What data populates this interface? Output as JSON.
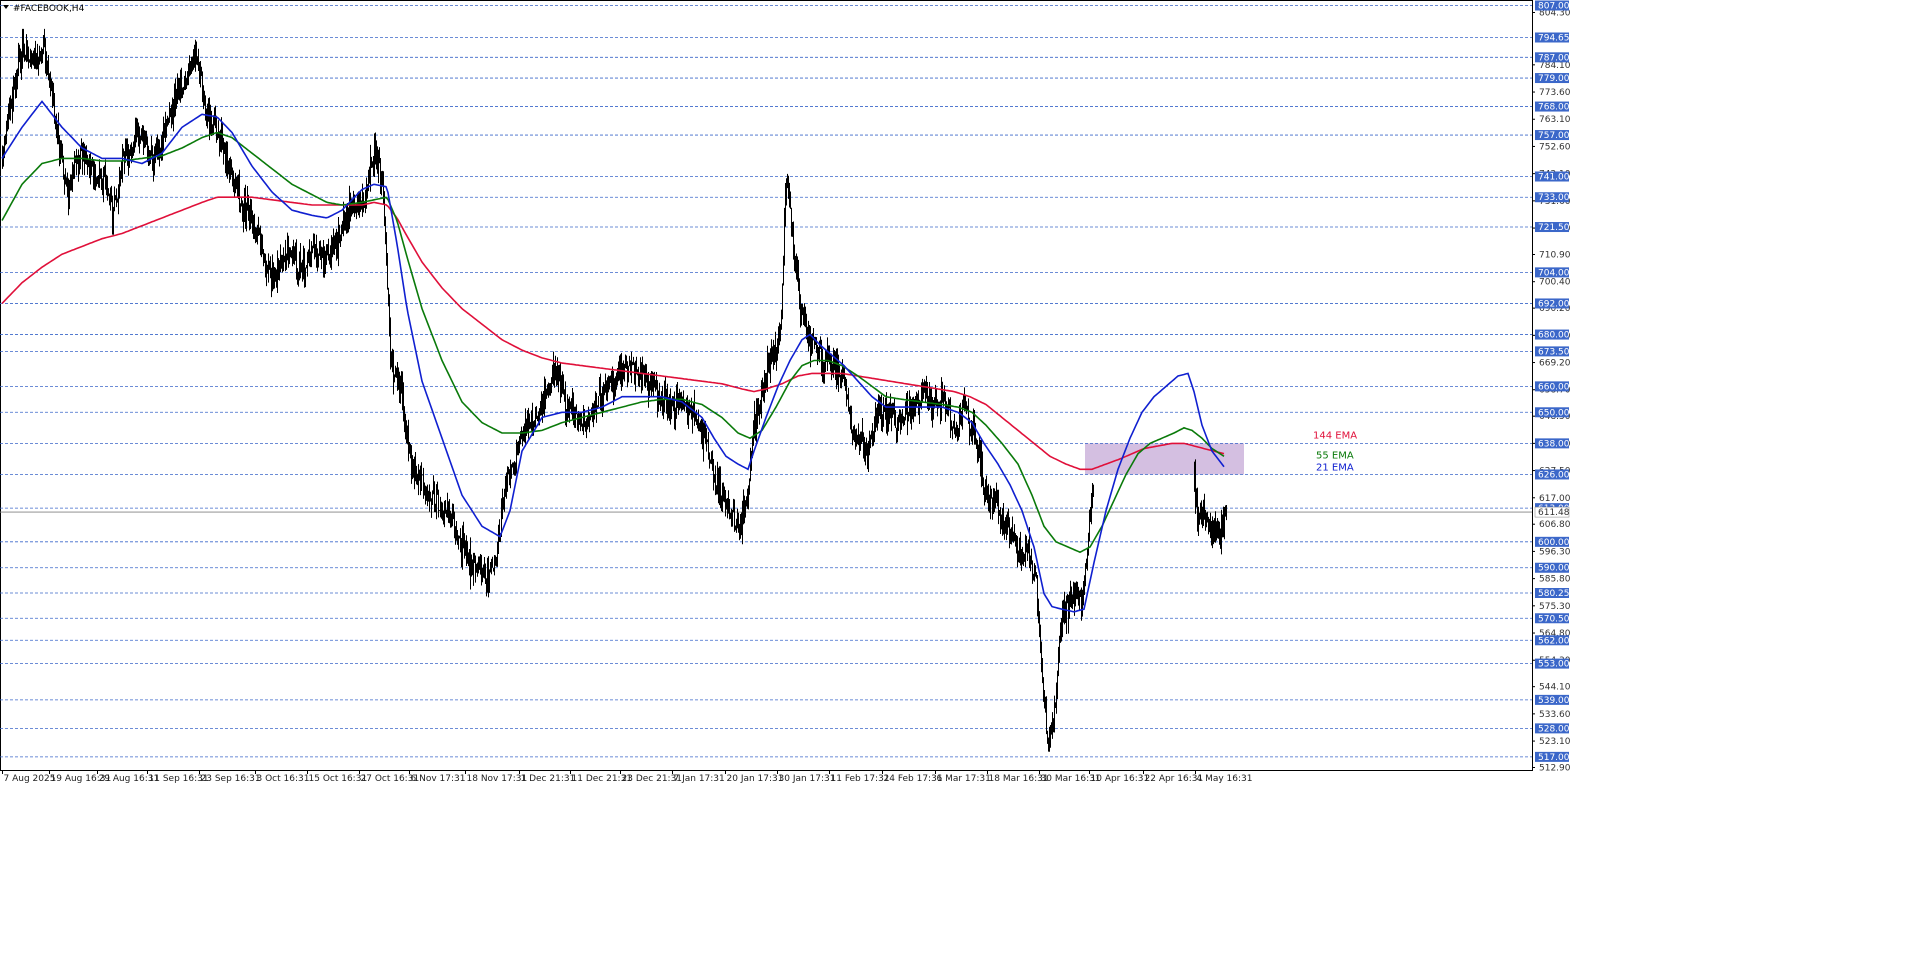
{
  "window": {
    "symbol_title": "#FACEBOOK,H4"
  },
  "colors": {
    "background": "#ffffff",
    "grid": "#3b67c9",
    "candle": "#000000",
    "ema21": "#1020d0",
    "ema55": "#0a7a0a",
    "ema144": "#e0103a",
    "zone": "#cdb4dc",
    "label_box": "#3b67c9"
  },
  "chart_data": {
    "type": "candlestick",
    "timeframe": "H4",
    "ylim": [
      512.9,
      807.0
    ],
    "level_lines": [
      807.0,
      794.65,
      787.0,
      779.0,
      768.0,
      757.0,
      741.0,
      733.0,
      721.5,
      704.0,
      692.0,
      680.0,
      673.5,
      660.0,
      650.0,
      638.0,
      626.0,
      613.0,
      600.0,
      590.0,
      580.25,
      570.5,
      562.0,
      553.0,
      539.0,
      528.0,
      517.0
    ],
    "level_labels": [
      "807.00",
      "794.65",
      "787.00",
      "779.00",
      "768.00",
      "757.00",
      "741.00",
      "733.00",
      "721.50",
      "704.00",
      "692.00",
      "680.00",
      "673.50",
      "660.00",
      "650.00",
      "638.00",
      "626.00",
      "613.00",
      "600.00",
      "590.00",
      "580.25",
      "570.50",
      "562.00",
      "553.00",
      "539.00",
      "528.00",
      "517.00"
    ],
    "y_ticks": [
      "804.30",
      "784.10",
      "773.60",
      "763.10",
      "752.60",
      "742.10",
      "731.60",
      "721.10",
      "710.90",
      "700.40",
      "690.20",
      "679.70",
      "669.20",
      "658.70",
      "648.50",
      "638.00",
      "627.50",
      "617.00",
      "606.80",
      "596.30",
      "585.80",
      "575.30",
      "564.80",
      "554.30",
      "544.10",
      "533.60",
      "523.10",
      "512.90"
    ],
    "y_tick_values": [
      804.3,
      784.1,
      773.6,
      763.1,
      752.6,
      742.1,
      731.6,
      721.1,
      710.9,
      700.4,
      690.2,
      679.7,
      669.2,
      658.7,
      648.5,
      638.0,
      627.5,
      617.0,
      606.8,
      596.3,
      585.8,
      575.3,
      564.8,
      554.3,
      544.1,
      533.6,
      523.1,
      512.9
    ],
    "current_price": "611.48",
    "current_price_value": 611.48,
    "x_ticks": [
      "7 Aug 2025",
      "19 Aug 16:31",
      "29 Aug 16:31",
      "11 Sep 16:31",
      "23 Sep 16:31",
      "3 Oct 16:31",
      "15 Oct 16:31",
      "27 Oct 16:31",
      "6 Nov 17:31",
      "18 Nov 17:31",
      "1 Dec 21:31",
      "11 Dec 21:31",
      "23 Dec 21:31",
      "7 Jan 17:31",
      "20 Jan 17:31",
      "30 Jan 17:31",
      "11 Feb 17:31",
      "24 Feb 17:31",
      "6 Mar 17:31",
      "18 Mar 16:31",
      "30 Mar 16:31",
      "10 Apr 16:31",
      "22 Apr 16:31",
      "4 May 16:31"
    ],
    "x_tick_index": [
      0,
      47,
      95,
      145,
      197,
      253,
      305,
      357,
      407,
      463,
      517,
      568,
      618,
      670,
      723,
      775,
      827,
      880,
      933,
      985,
      1037,
      1087,
      1141,
      1193
    ],
    "n_bars": 1225,
    "price_anchors": [
      [
        0,
        748
      ],
      [
        4,
        760
      ],
      [
        10,
        772
      ],
      [
        20,
        790
      ],
      [
        28,
        785
      ],
      [
        42,
        788
      ],
      [
        50,
        770
      ],
      [
        58,
        748
      ],
      [
        66,
        735
      ],
      [
        78,
        752
      ],
      [
        92,
        742
      ],
      [
        104,
        740
      ],
      [
        110,
        725
      ],
      [
        122,
        748
      ],
      [
        135,
        758
      ],
      [
        150,
        748
      ],
      [
        160,
        755
      ],
      [
        172,
        770
      ],
      [
        185,
        782
      ],
      [
        195,
        788
      ],
      [
        204,
        765
      ],
      [
        215,
        760
      ],
      [
        230,
        740
      ],
      [
        242,
        728
      ],
      [
        252,
        722
      ],
      [
        262,
        710
      ],
      [
        272,
        700
      ],
      [
        285,
        712
      ],
      [
        298,
        705
      ],
      [
        312,
        712
      ],
      [
        325,
        710
      ],
      [
        340,
        720
      ],
      [
        350,
        732
      ],
      [
        362,
        732
      ],
      [
        372,
        750
      ],
      [
        380,
        740
      ],
      [
        388,
        672
      ],
      [
        398,
        660
      ],
      [
        410,
        628
      ],
      [
        420,
        622
      ],
      [
        432,
        618
      ],
      [
        445,
        612
      ],
      [
        458,
        600
      ],
      [
        472,
        590
      ],
      [
        484,
        588
      ],
      [
        494,
        592
      ],
      [
        502,
        620
      ],
      [
        512,
        632
      ],
      [
        522,
        645
      ],
      [
        534,
        648
      ],
      [
        546,
        662
      ],
      [
        554,
        668
      ],
      [
        564,
        652
      ],
      [
        578,
        645
      ],
      [
        592,
        652
      ],
      [
        604,
        660
      ],
      [
        616,
        665
      ],
      [
        630,
        668
      ],
      [
        642,
        662
      ],
      [
        656,
        658
      ],
      [
        668,
        652
      ],
      [
        680,
        655
      ],
      [
        692,
        648
      ],
      [
        702,
        640
      ],
      [
        712,
        625
      ],
      [
        724,
        615
      ],
      [
        736,
        605
      ],
      [
        744,
        615
      ],
      [
        752,
        645
      ],
      [
        760,
        660
      ],
      [
        770,
        670
      ],
      [
        778,
        680
      ],
      [
        784,
        740
      ],
      [
        790,
        718
      ],
      [
        798,
        690
      ],
      [
        808,
        678
      ],
      [
        818,
        672
      ],
      [
        830,
        668
      ],
      [
        842,
        662
      ],
      [
        852,
        640
      ],
      [
        864,
        635
      ],
      [
        876,
        650
      ],
      [
        888,
        652
      ],
      [
        898,
        645
      ],
      [
        910,
        652
      ],
      [
        922,
        658
      ],
      [
        934,
        652
      ],
      [
        944,
        655
      ],
      [
        952,
        640
      ],
      [
        962,
        652
      ],
      [
        974,
        638
      ],
      [
        984,
        618
      ],
      [
        996,
        614
      ],
      [
        1006,
        605
      ],
      [
        1016,
        595
      ],
      [
        1026,
        596
      ],
      [
        1034,
        582
      ],
      [
        1040,
        545
      ],
      [
        1046,
        522
      ],
      [
        1052,
        535
      ],
      [
        1058,
        568
      ],
      [
        1064,
        575
      ],
      [
        1072,
        580
      ],
      [
        1080,
        575
      ],
      [
        1088,
        612
      ],
      [
        1096,
        628
      ],
      [
        1104,
        632
      ],
      [
        1112,
        640
      ],
      [
        1116,
        672
      ],
      [
        1124,
        668
      ],
      [
        1132,
        672
      ],
      [
        1138,
        688
      ],
      [
        1146,
        675
      ],
      [
        1156,
        668
      ],
      [
        1164,
        658
      ],
      [
        1172,
        672
      ],
      [
        1180,
        672
      ],
      [
        1186,
        668
      ],
      [
        1190,
        665
      ],
      [
        1193,
        612
      ],
      [
        1200,
        610
      ],
      [
        1208,
        607
      ],
      [
        1214,
        605
      ],
      [
        1218,
        602
      ],
      [
        1222,
        610
      ],
      [
        1224,
        611.48
      ]
    ],
    "ema21_anchors": [
      [
        0,
        748
      ],
      [
        20,
        760
      ],
      [
        40,
        770
      ],
      [
        60,
        760
      ],
      [
        80,
        752
      ],
      [
        100,
        748
      ],
      [
        120,
        748
      ],
      [
        140,
        746
      ],
      [
        160,
        750
      ],
      [
        180,
        760
      ],
      [
        200,
        765
      ],
      [
        215,
        764
      ],
      [
        230,
        758
      ],
      [
        250,
        745
      ],
      [
        270,
        735
      ],
      [
        290,
        728
      ],
      [
        310,
        726
      ],
      [
        325,
        725
      ],
      [
        340,
        728
      ],
      [
        360,
        736
      ],
      [
        372,
        738
      ],
      [
        385,
        737
      ],
      [
        395,
        715
      ],
      [
        405,
        690
      ],
      [
        420,
        662
      ],
      [
        440,
        640
      ],
      [
        460,
        618
      ],
      [
        480,
        606
      ],
      [
        498,
        602
      ],
      [
        508,
        612
      ],
      [
        520,
        635
      ],
      [
        540,
        648
      ],
      [
        560,
        650
      ],
      [
        580,
        650
      ],
      [
        600,
        652
      ],
      [
        620,
        656
      ],
      [
        640,
        656
      ],
      [
        660,
        656
      ],
      [
        680,
        654
      ],
      [
        700,
        648
      ],
      [
        712,
        640
      ],
      [
        724,
        633
      ],
      [
        736,
        630
      ],
      [
        746,
        628
      ],
      [
        752,
        635
      ],
      [
        764,
        648
      ],
      [
        776,
        660
      ],
      [
        788,
        670
      ],
      [
        800,
        678
      ],
      [
        808,
        680
      ],
      [
        818,
        676
      ],
      [
        830,
        672
      ],
      [
        842,
        668
      ],
      [
        856,
        662
      ],
      [
        870,
        656
      ],
      [
        884,
        652
      ],
      [
        900,
        652
      ],
      [
        920,
        652
      ],
      [
        940,
        652
      ],
      [
        956,
        650
      ],
      [
        970,
        646
      ],
      [
        982,
        638
      ],
      [
        996,
        630
      ],
      [
        1008,
        622
      ],
      [
        1020,
        612
      ],
      [
        1032,
        598
      ],
      [
        1042,
        580
      ],
      [
        1050,
        575
      ],
      [
        1060,
        574
      ],
      [
        1072,
        573
      ],
      [
        1082,
        574
      ],
      [
        1092,
        592
      ],
      [
        1104,
        612
      ],
      [
        1116,
        628
      ],
      [
        1128,
        640
      ],
      [
        1140,
        650
      ],
      [
        1152,
        656
      ],
      [
        1164,
        660
      ],
      [
        1176,
        664
      ],
      [
        1186,
        665
      ],
      [
        1192,
        658
      ],
      [
        1200,
        645
      ],
      [
        1210,
        635
      ],
      [
        1218,
        631
      ],
      [
        1222,
        629
      ]
    ],
    "ema55_anchors": [
      [
        0,
        724
      ],
      [
        20,
        738
      ],
      [
        40,
        746
      ],
      [
        60,
        748
      ],
      [
        80,
        748
      ],
      [
        100,
        747
      ],
      [
        120,
        747
      ],
      [
        140,
        748
      ],
      [
        160,
        749
      ],
      [
        180,
        752
      ],
      [
        200,
        756
      ],
      [
        215,
        758
      ],
      [
        230,
        756
      ],
      [
        250,
        750
      ],
      [
        270,
        744
      ],
      [
        290,
        738
      ],
      [
        310,
        734
      ],
      [
        325,
        731
      ],
      [
        340,
        730
      ],
      [
        360,
        731
      ],
      [
        372,
        732
      ],
      [
        385,
        733
      ],
      [
        395,
        724
      ],
      [
        405,
        710
      ],
      [
        420,
        690
      ],
      [
        440,
        670
      ],
      [
        460,
        654
      ],
      [
        480,
        646
      ],
      [
        500,
        642
      ],
      [
        520,
        642
      ],
      [
        540,
        643
      ],
      [
        560,
        646
      ],
      [
        580,
        648
      ],
      [
        600,
        650
      ],
      [
        620,
        652
      ],
      [
        640,
        654
      ],
      [
        660,
        655
      ],
      [
        680,
        655
      ],
      [
        700,
        653
      ],
      [
        720,
        648
      ],
      [
        736,
        642
      ],
      [
        748,
        640
      ],
      [
        760,
        643
      ],
      [
        774,
        652
      ],
      [
        788,
        662
      ],
      [
        800,
        668
      ],
      [
        812,
        670
      ],
      [
        826,
        670
      ],
      [
        840,
        668
      ],
      [
        856,
        664
      ],
      [
        870,
        660
      ],
      [
        884,
        656
      ],
      [
        900,
        655
      ],
      [
        920,
        654
      ],
      [
        940,
        653
      ],
      [
        956,
        652
      ],
      [
        970,
        650
      ],
      [
        984,
        645
      ],
      [
        1000,
        638
      ],
      [
        1016,
        630
      ],
      [
        1030,
        618
      ],
      [
        1042,
        606
      ],
      [
        1054,
        600
      ],
      [
        1066,
        598
      ],
      [
        1078,
        596
      ],
      [
        1088,
        598
      ],
      [
        1100,
        606
      ],
      [
        1112,
        616
      ],
      [
        1124,
        626
      ],
      [
        1136,
        634
      ],
      [
        1148,
        638
      ],
      [
        1160,
        640
      ],
      [
        1172,
        642
      ],
      [
        1182,
        644
      ],
      [
        1190,
        643
      ],
      [
        1200,
        640
      ],
      [
        1210,
        636
      ],
      [
        1218,
        634
      ],
      [
        1222,
        633
      ]
    ],
    "ema144_anchors": [
      [
        0,
        692
      ],
      [
        20,
        700
      ],
      [
        40,
        706
      ],
      [
        60,
        711
      ],
      [
        80,
        714
      ],
      [
        100,
        717
      ],
      [
        120,
        719
      ],
      [
        140,
        722
      ],
      [
        160,
        725
      ],
      [
        180,
        728
      ],
      [
        200,
        731
      ],
      [
        215,
        733
      ],
      [
        230,
        733
      ],
      [
        250,
        733
      ],
      [
        270,
        732
      ],
      [
        290,
        731
      ],
      [
        310,
        730
      ],
      [
        325,
        730
      ],
      [
        340,
        730
      ],
      [
        360,
        730
      ],
      [
        372,
        731
      ],
      [
        385,
        730
      ],
      [
        395,
        725
      ],
      [
        405,
        718
      ],
      [
        420,
        708
      ],
      [
        440,
        698
      ],
      [
        460,
        690
      ],
      [
        480,
        684
      ],
      [
        500,
        678
      ],
      [
        520,
        674
      ],
      [
        540,
        671
      ],
      [
        560,
        669
      ],
      [
        580,
        668
      ],
      [
        600,
        667
      ],
      [
        620,
        666
      ],
      [
        640,
        665
      ],
      [
        660,
        664
      ],
      [
        680,
        663
      ],
      [
        700,
        662
      ],
      [
        720,
        661
      ],
      [
        740,
        659
      ],
      [
        752,
        658
      ],
      [
        764,
        659
      ],
      [
        780,
        661
      ],
      [
        796,
        664
      ],
      [
        810,
        665
      ],
      [
        826,
        665
      ],
      [
        840,
        665
      ],
      [
        856,
        664
      ],
      [
        872,
        663
      ],
      [
        888,
        662
      ],
      [
        904,
        661
      ],
      [
        920,
        660
      ],
      [
        936,
        659
      ],
      [
        952,
        658
      ],
      [
        968,
        656
      ],
      [
        984,
        653
      ],
      [
        1000,
        648
      ],
      [
        1016,
        643
      ],
      [
        1032,
        638
      ],
      [
        1048,
        633
      ],
      [
        1064,
        630
      ],
      [
        1078,
        628
      ],
      [
        1090,
        628
      ],
      [
        1104,
        630
      ],
      [
        1118,
        632
      ],
      [
        1130,
        634
      ],
      [
        1142,
        636
      ],
      [
        1156,
        637
      ],
      [
        1170,
        638
      ],
      [
        1182,
        638
      ],
      [
        1192,
        637
      ],
      [
        1202,
        636
      ],
      [
        1212,
        635
      ],
      [
        1222,
        634
      ]
    ],
    "zone": {
      "bar_from": 1083,
      "bar_to": 1242,
      "price_top": 638.0,
      "price_bottom": 626.0
    },
    "ema_labels": {
      "ema144": "144 EMA",
      "ema55": "55 EMA",
      "ema21": "21 EMA"
    },
    "ema_label_prices": {
      "ema144": 641.0,
      "ema55": 633.4,
      "ema21": 628.6
    }
  }
}
